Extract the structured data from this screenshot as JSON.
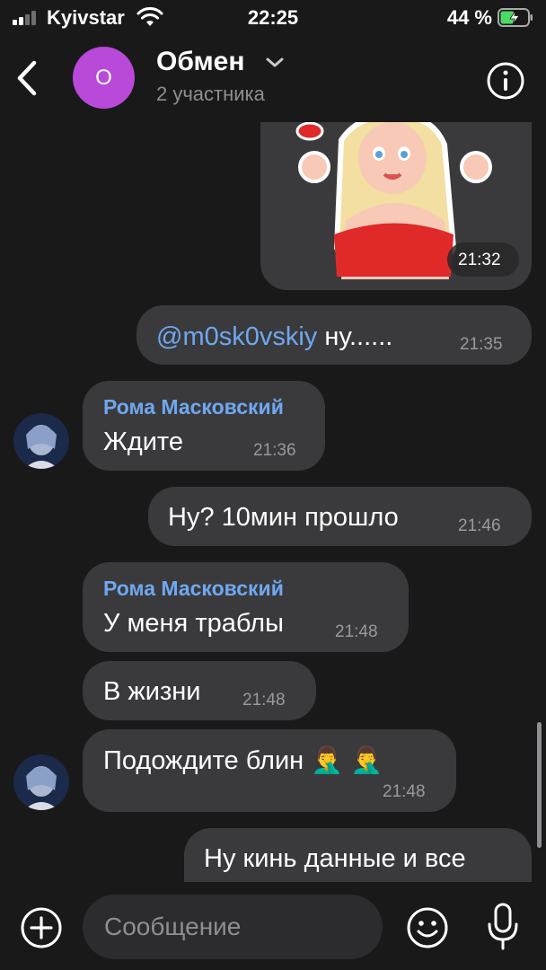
{
  "status_bar": {
    "carrier": "Kyivstar",
    "time": "22:25",
    "battery_percent": "44 %"
  },
  "header": {
    "avatar_letter": "О",
    "title": "Обмен",
    "subtitle": "2 участника",
    "avatar_color": "#b949d8"
  },
  "messages": [
    {
      "type": "sticker",
      "direction": "outgoing",
      "time": "21:32"
    },
    {
      "type": "text",
      "direction": "outgoing",
      "mention": "@m0sk0vskiy",
      "text": " ну......",
      "time": "21:35"
    },
    {
      "type": "text",
      "direction": "incoming",
      "sender": "Рома Масковский",
      "text": "Ждите",
      "time": "21:36"
    },
    {
      "type": "text",
      "direction": "outgoing",
      "text": "Ну? 10мин прошло",
      "time": "21:46"
    },
    {
      "type": "text",
      "direction": "incoming",
      "sender": "Рома Масковский",
      "text": "У меня траблы",
      "time": "21:48"
    },
    {
      "type": "text",
      "direction": "incoming",
      "text": "В жизни",
      "time": "21:48"
    },
    {
      "type": "text",
      "direction": "incoming",
      "text": "Подождите блин",
      "emoji": "🤦‍♂️ 🤦‍♂️",
      "time": "21:48"
    },
    {
      "type": "text",
      "direction": "outgoing",
      "text": "Ну кинь данные и все"
    }
  ],
  "input": {
    "placeholder": "Сообщение"
  },
  "colors": {
    "background": "#19191a",
    "bubble": "#3a3a3c",
    "accent_blue": "#6fa8f0",
    "battery_green": "#4cd964"
  },
  "icons": [
    "signal-icon",
    "wifi-icon",
    "battery-icon",
    "back-arrow-icon",
    "chevron-down-icon",
    "info-icon",
    "plus-icon",
    "emoji-icon",
    "microphone-icon"
  ]
}
